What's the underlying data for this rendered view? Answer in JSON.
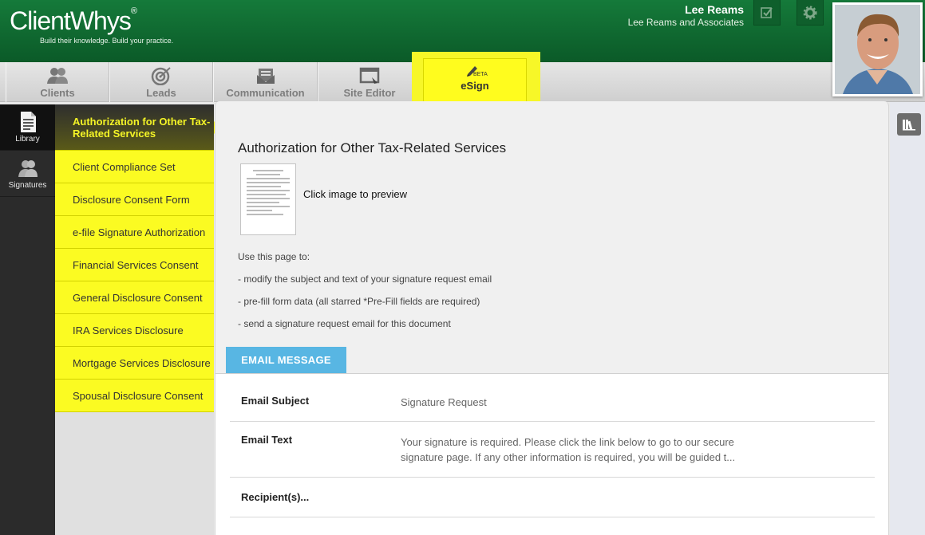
{
  "header": {
    "logo": "ClientWhys",
    "logo_reg": "®",
    "tagline": "Build their knowledge. Build your practice.",
    "user_name": "Lee Reams",
    "user_company": "Lee Reams and Associates",
    "bg_color": "#0b6b31"
  },
  "tabs": [
    {
      "label": "Clients",
      "icon": "clients-icon"
    },
    {
      "label": "Leads",
      "icon": "target-icon"
    },
    {
      "label": "Communication",
      "icon": "envelope-icon"
    },
    {
      "label": "Site Editor",
      "icon": "browser-icon"
    },
    {
      "label": "eSign",
      "icon": "pen-icon",
      "badge": "BETA",
      "active": true
    }
  ],
  "leftbar": [
    {
      "label": "Library",
      "icon": "document-icon",
      "active": true
    },
    {
      "label": "Signatures",
      "icon": "people-icon"
    }
  ],
  "documents": [
    "Authorization for Other Tax-Related Services",
    "Client Compliance Set",
    "Disclosure Consent Form",
    "e-file Signature Authorization",
    "Financial Services Consent",
    "General Disclosure Consent",
    "IRA Services Disclosure",
    "Mortgage Services Disclosure",
    "Spousal Disclosure Consent"
  ],
  "main": {
    "title": "Authorization for Other Tax-Related Services",
    "preview_text": "Click image to preview",
    "intro": [
      "Use this page to:",
      "- modify the subject and text of your signature request email",
      "- pre-fill form data (all starred *Pre-Fill fields are required)",
      "- send a signature request email for this document"
    ],
    "email_tab": "EMAIL MESSAGE",
    "fields": {
      "subject_label": "Email Subject",
      "subject_value": "Signature Request",
      "text_label": "Email Text",
      "text_value": "Your signature is required. Please click the link below to go to our secure signature page. If any other information is required, you will be guided t...",
      "recipients_label": "Recipient(s)..."
    }
  },
  "colors": {
    "highlight": "#fffc1e",
    "accent_blue": "#58b6e3"
  }
}
